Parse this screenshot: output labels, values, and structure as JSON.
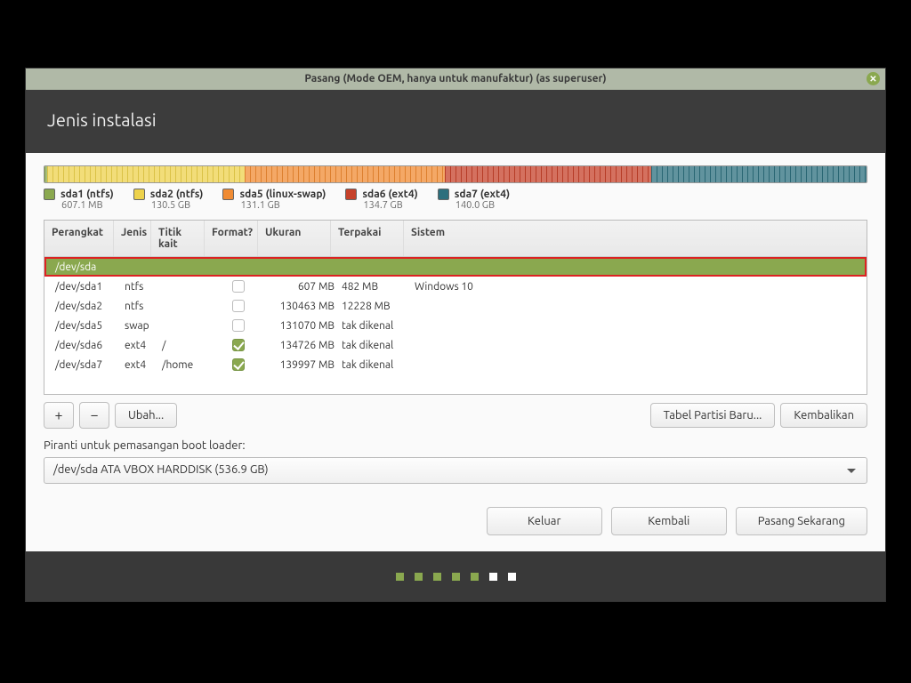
{
  "window": {
    "title": "Pasang (Mode OEM, hanya untuk manufaktur) (as superuser)"
  },
  "header": {
    "title": "Jenis instalasi"
  },
  "colors": {
    "sda1": "#8aa84f",
    "sda2": "#edd24c",
    "sda5": "#f08b33",
    "sda6": "#c6412a",
    "sda7": "#2c6f7d"
  },
  "segments": [
    {
      "key": "sda1",
      "pct": 0.3
    },
    {
      "key": "sda2",
      "pct": 24.0
    },
    {
      "key": "sda5",
      "pct": 24.4
    },
    {
      "key": "sda6",
      "pct": 25.1
    },
    {
      "key": "sda7",
      "pct": 26.2
    }
  ],
  "legend": [
    {
      "key": "sda1",
      "label": "sda1 (ntfs)",
      "sub": "607.1 MB"
    },
    {
      "key": "sda2",
      "label": "sda2 (ntfs)",
      "sub": "130.5 GB"
    },
    {
      "key": "sda5",
      "label": "sda5 (linux-swap)",
      "sub": "131.1 GB"
    },
    {
      "key": "sda6",
      "label": "sda6 (ext4)",
      "sub": "134.7 GB"
    },
    {
      "key": "sda7",
      "label": "sda7 (ext4)",
      "sub": "140.0 GB"
    }
  ],
  "columns": {
    "device": "Perangkat",
    "type": "Jenis",
    "mount": "Titik kait",
    "format": "Format?",
    "size": "Ukuran",
    "used": "Terpakai",
    "system": "Sistem"
  },
  "rows": [
    {
      "device": "/dev/sda",
      "type": "",
      "mount": "",
      "format": null,
      "size": "",
      "used": "",
      "system": "",
      "selected": true
    },
    {
      "device": "/dev/sda1",
      "type": "ntfs",
      "mount": "",
      "format": false,
      "size": "607 MB",
      "used": "482 MB",
      "system": "Windows 10"
    },
    {
      "device": "/dev/sda2",
      "type": "ntfs",
      "mount": "",
      "format": false,
      "size": "130463 MB",
      "used": "12228 MB",
      "system": ""
    },
    {
      "device": "/dev/sda5",
      "type": "swap",
      "mount": "",
      "format": false,
      "size": "131070 MB",
      "used": "tak dikenal",
      "system": ""
    },
    {
      "device": "/dev/sda6",
      "type": "ext4",
      "mount": "/",
      "format": true,
      "size": "134726 MB",
      "used": "tak dikenal",
      "system": ""
    },
    {
      "device": "/dev/sda7",
      "type": "ext4",
      "mount": "/home",
      "format": true,
      "size": "139997 MB",
      "used": "tak dikenal",
      "system": ""
    }
  ],
  "actions": {
    "add": "+",
    "remove": "−",
    "change": "Ubah...",
    "newtable": "Tabel Partisi Baru...",
    "revert": "Kembalikan"
  },
  "bootloader": {
    "label": "Piranti untuk pemasangan boot loader:",
    "value": "/dev/sda   ATA VBOX HARDDISK (536.9 GB)"
  },
  "mainbuttons": {
    "quit": "Keluar",
    "back": "Kembali",
    "install": "Pasang Sekarang"
  },
  "progress": {
    "done": 5,
    "total": 7
  }
}
